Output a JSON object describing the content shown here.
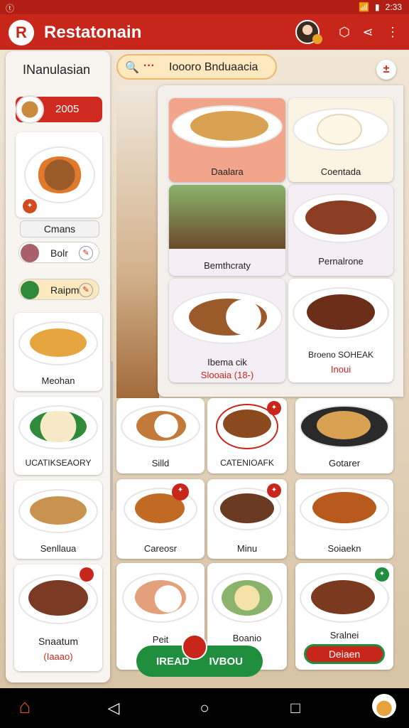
{
  "status": {
    "left": "ⓣ",
    "time": "2:33"
  },
  "app": {
    "title": "Restatonain",
    "logo_letter": "R"
  },
  "search": {
    "text": "Ioooro Bnduaacia",
    "dash": "···"
  },
  "sidebar": {
    "heading": "INanulasian",
    "selected": "2005",
    "card_label": "Cmans",
    "pills": [
      {
        "label": "Bolr"
      },
      {
        "label": "Raipm"
      }
    ],
    "cards": [
      "Meohan",
      "UCATIKSEAORY",
      "Senllaua"
    ],
    "last_card": {
      "title": "Snaatum",
      "sub": "(Iaaao)"
    }
  },
  "featured": [
    {
      "title": "Daalara"
    },
    {
      "title": "Coentada"
    },
    {
      "title": "Bemthcraty"
    },
    {
      "title": "Pernalrone"
    },
    {
      "title": "Ibema cik",
      "sub": "Slooaia (18-)"
    },
    {
      "title": "Broeno SOHEAK",
      "sub": "Inoui"
    }
  ],
  "grid": [
    {
      "title": "Silld"
    },
    {
      "title": "CATENIOAFK"
    },
    {
      "title": "Gotarer"
    },
    {
      "title": "Careosr"
    },
    {
      "title": "Minu"
    },
    {
      "title": "Soiaekn"
    },
    {
      "title": "Peit"
    },
    {
      "title": "Boanio"
    },
    {
      "title": "Sralnei",
      "button": "Deiaen"
    }
  ],
  "bottom_button": {
    "left": "IREAD",
    "right": "IVBOU"
  },
  "nav": {
    "back": "◁",
    "home": "○",
    "recent": "□"
  }
}
